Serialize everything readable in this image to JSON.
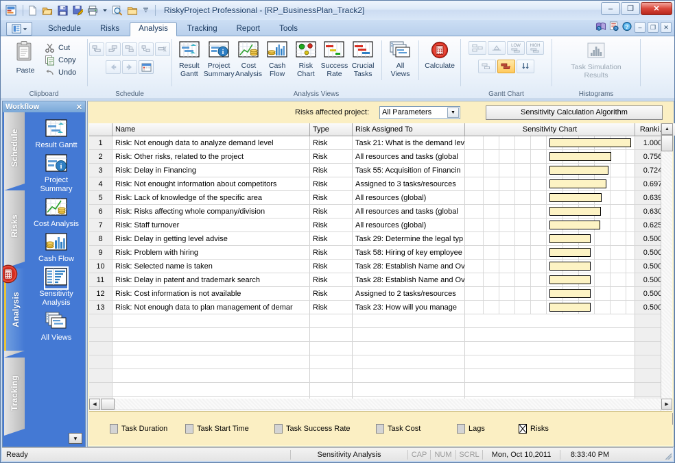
{
  "window": {
    "title": "RiskyProject Professional - [RP_BusinessPlan_Track2]",
    "minimize": "–",
    "maximize": "❐",
    "close": "✕"
  },
  "quick_access": {
    "icons": [
      "app-logo-icon",
      "new-icon",
      "open-icon",
      "save-icon",
      "save-as-icon",
      "print-icon",
      "print-dropdown-icon",
      "print-preview-icon",
      "folder-icon",
      "qat-dropdown-icon"
    ]
  },
  "ribbon": {
    "app_menu": "app-menu-icon",
    "tabs": [
      {
        "label": "Schedule",
        "active": false
      },
      {
        "label": "Risks",
        "active": false
      },
      {
        "label": "Analysis",
        "active": true
      },
      {
        "label": "Tracking",
        "active": false
      },
      {
        "label": "Report",
        "active": false
      },
      {
        "label": "Tools",
        "active": false
      }
    ],
    "right_icons": [
      "help-book-icon",
      "notes-icon",
      "help-icon"
    ],
    "right_buttons": [
      "–",
      "❐",
      "✕"
    ],
    "groups": {
      "clipboard": {
        "label": "Clipboard",
        "paste": "Paste",
        "cut": "Cut",
        "copy": "Copy",
        "undo": "Undo"
      },
      "schedule": {
        "label": "Schedule"
      },
      "analysis_views": {
        "label": "Analysis Views",
        "buttons": [
          {
            "l1": "Result",
            "l2": "Gantt"
          },
          {
            "l1": "Project",
            "l2": "Summary"
          },
          {
            "l1": "Cost",
            "l2": "Analysis"
          },
          {
            "l1": "Cash",
            "l2": "Flow"
          },
          {
            "l1": "Risk",
            "l2": "Chart"
          },
          {
            "l1": "Success",
            "l2": "Rate"
          },
          {
            "l1": "Crucial",
            "l2": "Tasks"
          }
        ],
        "all_views": {
          "l1": "All",
          "l2": "Views"
        },
        "calculate": "Calculate"
      },
      "gantt_chart": {
        "label": "Gantt Chart",
        "low": "LOW",
        "high": "HIGH"
      },
      "histograms": {
        "label": "Histograms",
        "task_simulation": "Task Simulation Results"
      }
    }
  },
  "workflow": {
    "title": "Workflow",
    "close": "✕",
    "tabs": [
      {
        "label": "Schedule",
        "active": false
      },
      {
        "label": "Risks",
        "active": false
      },
      {
        "label": "Analysis",
        "active": true
      },
      {
        "label": "Tracking",
        "active": false
      }
    ],
    "items": [
      {
        "label": "Result Gantt",
        "icon": "result-gantt-icon",
        "selected": false
      },
      {
        "label": "Project Summary",
        "icon": "project-summary-icon",
        "selected": false
      },
      {
        "label": "Cost Analysis",
        "icon": "cost-analysis-icon",
        "selected": false
      },
      {
        "label": "Cash Flow",
        "icon": "cash-flow-icon",
        "selected": false
      },
      {
        "label": "Sensitivity Analysis",
        "icon": "sensitivity-analysis-icon",
        "selected": true
      },
      {
        "label": "All Views",
        "icon": "all-views-icon",
        "selected": false
      }
    ],
    "scroll_down": "▼"
  },
  "filter_bar": {
    "label": "Risks affected project:",
    "combo_value": "All Parameters",
    "combo_arrow": "▼",
    "calc_button": "Sensitivity Calculation Algorithm"
  },
  "grid": {
    "columns": [
      "",
      "Name",
      "Type",
      "Risk Assigned To",
      "Sensitivity Chart",
      "Ranki...",
      ""
    ],
    "chart_max": 1.0,
    "rows": [
      {
        "n": "1",
        "name": "Risk: Not enough data to analyze demand level",
        "type": "Risk",
        "assigned": "Task 21: What is the demand lev",
        "rank": "1.000",
        "value": 1.0
      },
      {
        "n": "2",
        "name": "Risk: Other risks, related to the project",
        "type": "Risk",
        "assigned": "All resources and tasks (global",
        "rank": "0.756",
        "value": 0.756
      },
      {
        "n": "3",
        "name": "Risk: Delay in Financing",
        "type": "Risk",
        "assigned": "Task 55: Acquisition of Financin",
        "rank": "0.724",
        "value": 0.724
      },
      {
        "n": "4",
        "name": "Risk: Not enought information about competitors",
        "type": "Risk",
        "assigned": "Assigned to 3 tasks/resources",
        "rank": "0.697",
        "value": 0.697
      },
      {
        "n": "5",
        "name": "Risk: Lack of knowledge of the specific area",
        "type": "Risk",
        "assigned": "All resources (global)",
        "rank": "0.639",
        "value": 0.639
      },
      {
        "n": "6",
        "name": "Risk: Risks affecting whole company/division",
        "type": "Risk",
        "assigned": "All resources and tasks (global",
        "rank": "0.630",
        "value": 0.63
      },
      {
        "n": "7",
        "name": "Risk: Staff turnover",
        "type": "Risk",
        "assigned": "All resources (global)",
        "rank": "0.625",
        "value": 0.625
      },
      {
        "n": "8",
        "name": "Risk: Delay in getting level advise",
        "type": "Risk",
        "assigned": "Task 29: Determine the legal typ",
        "rank": "0.500",
        "value": 0.5
      },
      {
        "n": "9",
        "name": "Risk: Problem with hiring",
        "type": "Risk",
        "assigned": "Task 58: Hiring of key employee",
        "rank": "0.500",
        "value": 0.5
      },
      {
        "n": "10",
        "name": "Risk: Selected name is taken",
        "type": "Risk",
        "assigned": "Task 28: Establish Name and Ov",
        "rank": "0.500",
        "value": 0.5
      },
      {
        "n": "11",
        "name": "Risk: Delay in patent and trademark search",
        "type": "Risk",
        "assigned": "Task 28: Establish Name and Ov",
        "rank": "0.500",
        "value": 0.5
      },
      {
        "n": "12",
        "name": "Risk: Cost information is not available",
        "type": "Risk",
        "assigned": "Assigned to 2 tasks/resources",
        "rank": "0.500",
        "value": 0.5
      },
      {
        "n": "13",
        "name": "Risk: Not enough data to plan management of demar",
        "type": "Risk",
        "assigned": "Task 23: How will you manage",
        "rank": "0.500",
        "value": 0.5
      }
    ],
    "blank_rows": 7
  },
  "legend": {
    "items": [
      {
        "label": "Task Duration",
        "checked": false
      },
      {
        "label": "Task Start Time",
        "checked": false
      },
      {
        "label": "Task Success Rate",
        "checked": false
      },
      {
        "label": "Task Cost",
        "checked": false
      },
      {
        "label": "Lags",
        "checked": false
      },
      {
        "label": "Risks",
        "checked": true
      }
    ]
  },
  "status_bar": {
    "ready": "Ready",
    "view": "Sensitivity Analysis",
    "cap": "CAP",
    "num": "NUM",
    "scrl": "SCRL",
    "date": "Mon, Oct 10,2011",
    "time": "8:33:40 PM"
  },
  "colors": {
    "bar_fill": "#fdf3c4",
    "panel_yellow": "#fbefc3",
    "workflow_blue": "#4479d4",
    "accent": "#e0a22a"
  }
}
